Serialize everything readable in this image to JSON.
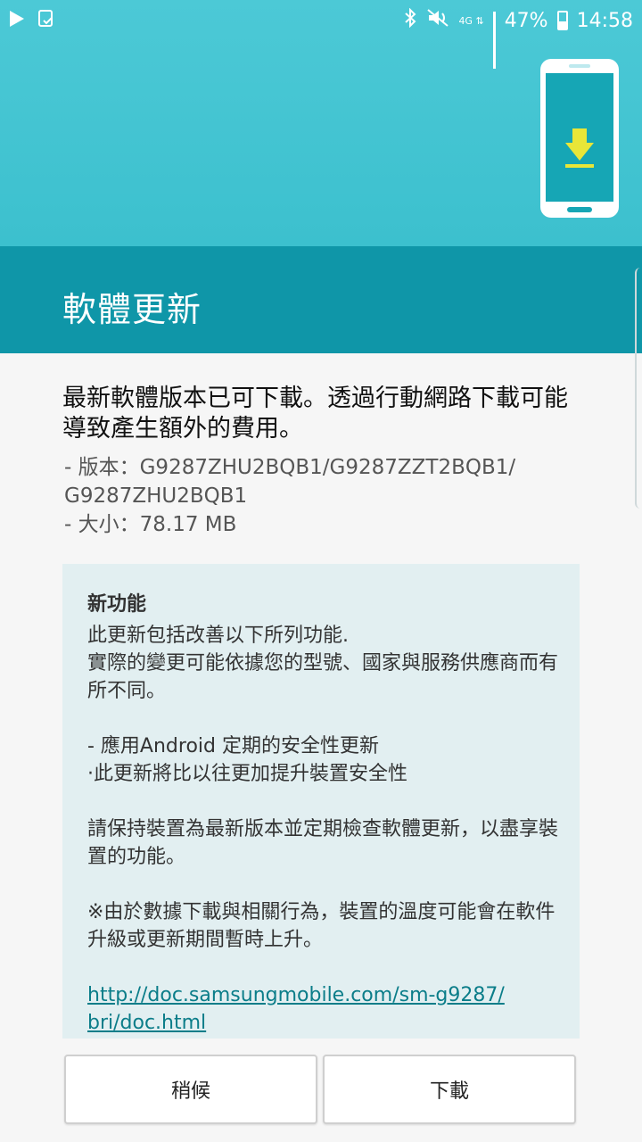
{
  "status_bar": {
    "left_icons": [
      "play-icon",
      "notification-icon"
    ],
    "network_label": "4G",
    "battery_percent": "47%",
    "time": "14:58"
  },
  "header": {
    "title": "軟體更新"
  },
  "update": {
    "message": "最新軟體版本已可下載。透過行動網路下載可能導致產生額外的費用。",
    "version_line": "- 版本：G9287ZHU2BQB1/G9287ZZT2BQB1/\nG9287ZHU2BQB1",
    "size_line": "- 大小：78.17 MB"
  },
  "release_notes": {
    "title": "新功能",
    "intro": "此更新包括改善以下所列功能.\n實際的變更可能依據您的型號、國家與服務供應商而有所不同。",
    "security_item": "- 應用Android 定期的安全性更新\n ·此更新將比以往更加提升裝置安全性",
    "advice": "請保持裝置為最新版本並定期檢查軟體更新，以盡享裝置的功能。",
    "note": "※由於數據下載與相關行為，裝置的溫度可能會在軟件升級或更新期間暫時上升。",
    "link": "http://doc.samsungmobile.com/sm-g9287/\nbri/doc.html"
  },
  "buttons": {
    "later_label": "稍候",
    "download_label": "下載"
  },
  "colors": {
    "banner": "#3cc0ce",
    "title_band": "#0f96a8",
    "notes_bg": "#e2eff1",
    "link": "#0b7d89"
  }
}
